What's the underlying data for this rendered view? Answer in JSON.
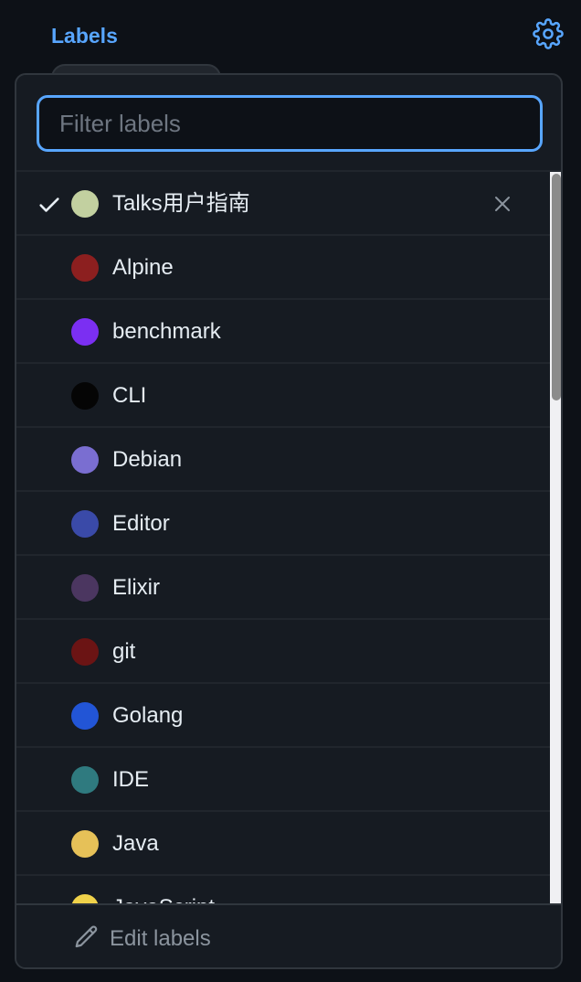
{
  "header": {
    "title": "Labels",
    "settings_icon": "gear-icon",
    "accent_color": "#58a6ff"
  },
  "filter": {
    "value": "",
    "placeholder": "Filter labels"
  },
  "labels": [
    {
      "name": "Talks用户指南",
      "color": "#c2d0a0",
      "selected": true
    },
    {
      "name": "Alpine",
      "color": "#8c1f1f",
      "selected": false
    },
    {
      "name": "benchmark",
      "color": "#7b2ff2",
      "selected": false
    },
    {
      "name": "CLI",
      "color": "#050505",
      "selected": false
    },
    {
      "name": "Debian",
      "color": "#7a6ed1",
      "selected": false
    },
    {
      "name": "Editor",
      "color": "#3a4aa8",
      "selected": false
    },
    {
      "name": "Elixir",
      "color": "#4b3660",
      "selected": false
    },
    {
      "name": "git",
      "color": "#6b1414",
      "selected": false
    },
    {
      "name": "Golang",
      "color": "#2255d6",
      "selected": false
    },
    {
      "name": "IDE",
      "color": "#2f7a7f",
      "selected": false
    },
    {
      "name": "Java",
      "color": "#e6c158",
      "selected": false
    },
    {
      "name": "JavaScript",
      "color": "#f0d24a",
      "selected": false
    }
  ],
  "footer": {
    "edit_label": "Edit labels",
    "edit_icon": "pencil-icon"
  }
}
